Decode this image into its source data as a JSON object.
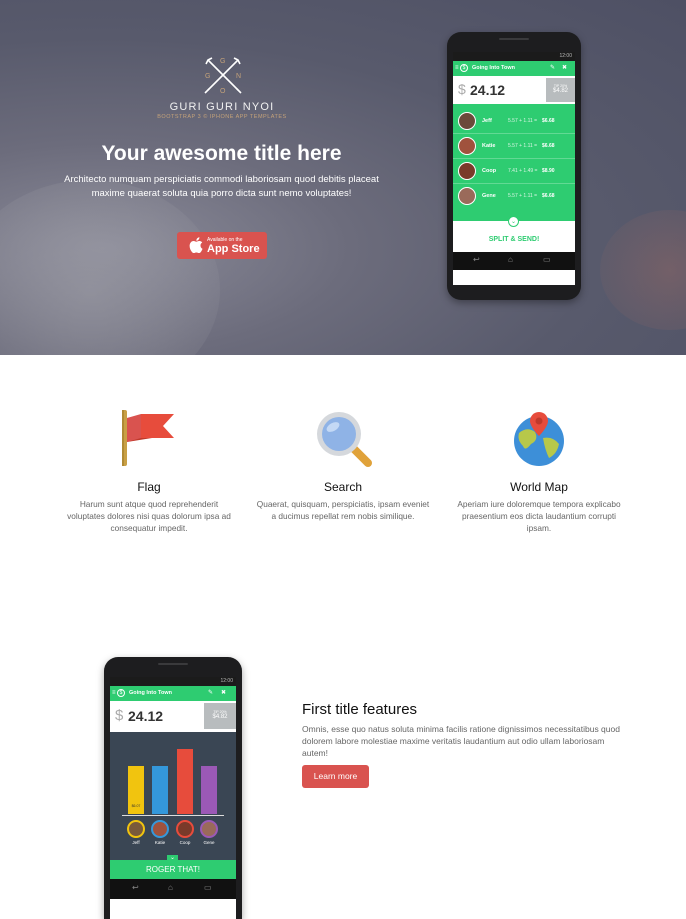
{
  "hero": {
    "logo_letters": [
      "G",
      "G",
      "N",
      "O"
    ],
    "brand": "GURI GURI NYOI",
    "brand_sub": "BOOTSTRAP 3  ©  IPHONE APP TEMPLATES",
    "title": "Your awesome title here",
    "text": "Architecto numquam perspiciatis commodi laboriosam quod debitis placeat maxime quaerat soluta quia porro dicta sunt nemo voluptates!",
    "appstore_small": "Available on the",
    "appstore_big": "App Store"
  },
  "phone1": {
    "status_time": "12:00",
    "app_title": "Going Into Town",
    "currency": "$",
    "amount": "24.12",
    "tip_label": "TIP 20%",
    "tip_value": "$4.82",
    "rows": [
      {
        "name": "Jeff",
        "expr": "5.57 + 1.11 = ",
        "total": "$6.68"
      },
      {
        "name": "Katie",
        "expr": "5.57 + 1.11 = ",
        "total": "$6.68"
      },
      {
        "name": "Coop",
        "expr": "7.41 + 1.49 = ",
        "total": "$8.90"
      },
      {
        "name": "Gene",
        "expr": "5.57 + 1.11 = ",
        "total": "$6.68"
      }
    ],
    "action": "SPLIT & SEND!"
  },
  "features": [
    {
      "icon": "flag-icon",
      "title": "Flag",
      "text": "Harum sunt atque quod reprehenderit voluptates dolores nisi quas dolorum ipsa ad consequatur impedit."
    },
    {
      "icon": "magnifier-icon",
      "title": "Search",
      "text": "Quaerat, quisquam, perspiciatis, ipsam eveniet a ducimus repellat rem nobis similique."
    },
    {
      "icon": "globe-pin-icon",
      "title": "World Map",
      "text": "Aperiam iure doloremque tempora explicabo praesentium eos dicta laudantium corrupti ipsam."
    }
  ],
  "phone2": {
    "status_time": "12:00",
    "app_title": "Going Into Town",
    "currency": "$",
    "amount": "24.12",
    "tip_label": "TIP 20%",
    "tip_value": "$4.82",
    "bar_value_label": "$6.07",
    "people": [
      "Jeff",
      "Katie",
      "Coop",
      "Gene"
    ],
    "action": "ROGER THAT!"
  },
  "feature2": {
    "title": "First title features",
    "text": "Omnis, esse quo natus soluta minima facilis ratione dignissimos necessitatibus quod dolorem labore molestiae maxime veritatis laudantium aut odio ullam laboriosam autem!",
    "button": "Learn more"
  },
  "colors": {
    "accent_red": "#d9534f",
    "app_green": "#2ecc71",
    "hero_bg": "#585a6c"
  }
}
